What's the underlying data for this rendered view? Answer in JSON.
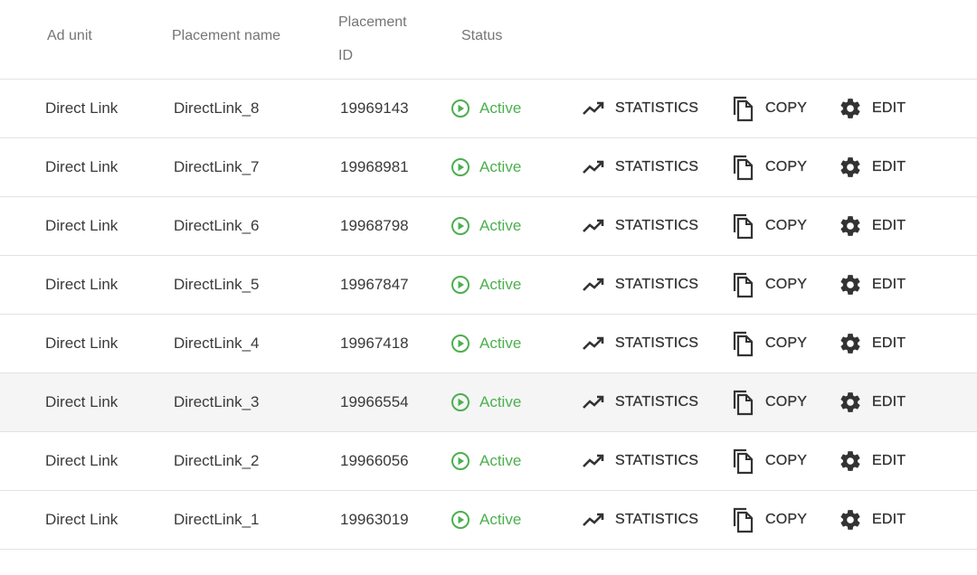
{
  "header": {
    "ad_unit": "Ad unit",
    "placement_name": "Placement name",
    "placement_id_line1": "Placement",
    "placement_id_line2": "ID",
    "status": "Status"
  },
  "actions": {
    "statistics": "STATISTICS",
    "copy": "COPY",
    "edit": "EDIT"
  },
  "colors": {
    "active": "#4caf50",
    "highlight_row": "#f5f5f5"
  },
  "rows": [
    {
      "ad_unit": "Direct Link",
      "name": "DirectLink_8",
      "id": "19969143",
      "status": "Active"
    },
    {
      "ad_unit": "Direct Link",
      "name": "DirectLink_7",
      "id": "19968981",
      "status": "Active"
    },
    {
      "ad_unit": "Direct Link",
      "name": "DirectLink_6",
      "id": "19968798",
      "status": "Active"
    },
    {
      "ad_unit": "Direct Link",
      "name": "DirectLink_5",
      "id": "19967847",
      "status": "Active"
    },
    {
      "ad_unit": "Direct Link",
      "name": "DirectLink_4",
      "id": "19967418",
      "status": "Active"
    },
    {
      "ad_unit": "Direct Link",
      "name": "DirectLink_3",
      "id": "19966554",
      "status": "Active",
      "hovered": true
    },
    {
      "ad_unit": "Direct Link",
      "name": "DirectLink_2",
      "id": "19966056",
      "status": "Active"
    },
    {
      "ad_unit": "Direct Link",
      "name": "DirectLink_1",
      "id": "19963019",
      "status": "Active"
    }
  ]
}
